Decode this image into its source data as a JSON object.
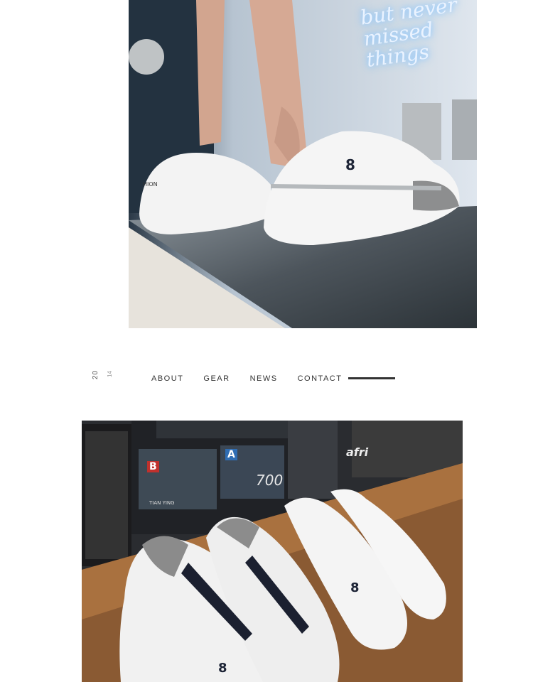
{
  "top_photo": {
    "neon_sign_lines": [
      "but never",
      "missed",
      "things"
    ],
    "shoe_badge": "8",
    "shoe_side_text": "HION"
  },
  "year_mark": {
    "part_a": "20",
    "part_b": "14"
  },
  "nav": {
    "items": [
      "ABOUT",
      "GEAR",
      "NEWS",
      "CONTACT"
    ]
  },
  "bottom_photo": {
    "panel_letters": [
      "B",
      "A"
    ],
    "display_number": "700",
    "brand_text": "TIAN YING",
    "poster_text": "afri",
    "shoe_badges": [
      "8",
      "8"
    ]
  },
  "colors": {
    "nav_text": "#333333",
    "rule": "#333333",
    "neon": "#eaf3ff"
  }
}
